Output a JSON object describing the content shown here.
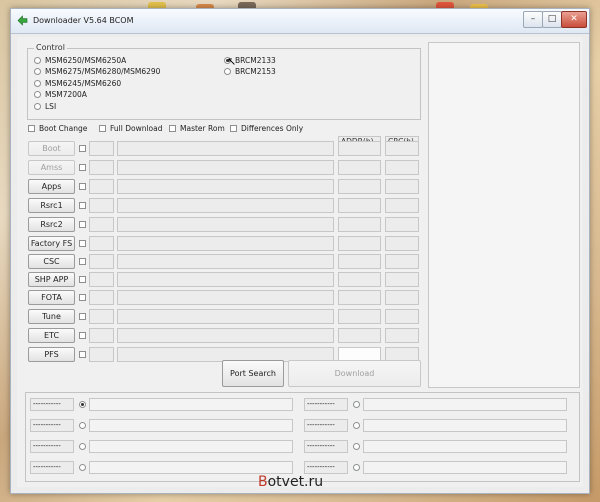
{
  "window": {
    "title": "Downloader V5.64 BCOM",
    "min_label": "–",
    "max_label": "□",
    "close_label": "✕"
  },
  "control": {
    "legend": "Control",
    "chipsets_left": [
      {
        "label": "MSM6250/MSM6250A",
        "selected": false
      },
      {
        "label": "MSM6275/MSM6280/MSM6290",
        "selected": false
      },
      {
        "label": "MSM6245/MSM6260",
        "selected": false
      },
      {
        "label": "MSM7200A",
        "selected": false
      },
      {
        "label": "LSI",
        "selected": false
      }
    ],
    "chipsets_right": [
      {
        "label": "BRCM2133",
        "selected": true
      },
      {
        "label": "BRCM2153",
        "selected": false
      }
    ]
  },
  "options": {
    "boot_change": "Boot Change",
    "full_download": "Full Download",
    "master_rom": "Master Rom",
    "differences_only": "Differences Only"
  },
  "columns": {
    "addr": "ADDR(h)",
    "crc": "CRC(h)"
  },
  "file_rows": [
    {
      "label": "Boot",
      "enabled": false
    },
    {
      "label": "Amss",
      "enabled": false
    },
    {
      "label": "Apps",
      "enabled": true
    },
    {
      "label": "Rsrc1",
      "enabled": true
    },
    {
      "label": "Rsrc2",
      "enabled": true
    },
    {
      "label": "Factory FS",
      "enabled": true
    },
    {
      "label": "CSC",
      "enabled": true
    },
    {
      "label": "SHP APP",
      "enabled": true
    },
    {
      "label": "FOTA",
      "enabled": true
    },
    {
      "label": "Tune",
      "enabled": true
    },
    {
      "label": "ETC",
      "enabled": true
    },
    {
      "label": "PFS",
      "enabled": true
    }
  ],
  "actions": {
    "port_search": "Port Search",
    "download": "Download"
  },
  "ports": [
    {
      "label": "-----------",
      "selected": true
    },
    {
      "label": "-----------",
      "selected": false
    },
    {
      "label": "-----------",
      "selected": false
    },
    {
      "label": "-----------",
      "selected": false
    },
    {
      "label": "-----------",
      "selected": false
    },
    {
      "label": "-----------",
      "selected": false
    },
    {
      "label": "-----------",
      "selected": false
    },
    {
      "label": "-----------",
      "selected": false
    }
  ],
  "watermark": {
    "accent": "B",
    "rest": "otvet.ru"
  }
}
